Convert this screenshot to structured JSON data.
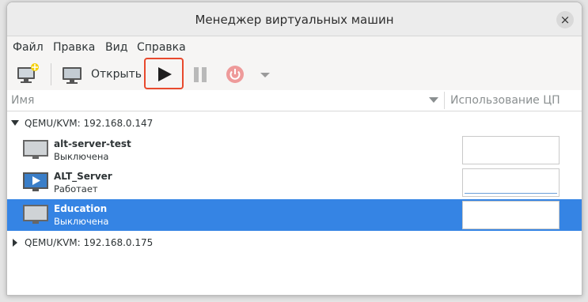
{
  "window": {
    "title": "Менеджер виртуальных машин",
    "close_glyph": "×"
  },
  "menu": [
    "Файл",
    "Правка",
    "Вид",
    "Справка"
  ],
  "toolbar": {
    "open_label": "Открыть",
    "icons": [
      "new-vm-icon",
      "monitor-icon",
      "play-icon",
      "pause-icon",
      "power-icon",
      "chevron-down-icon"
    ],
    "highlight_color": "#e8492d"
  },
  "columns": {
    "name": "Имя",
    "cpu": "Использование ЦП"
  },
  "connections": [
    {
      "label": "QEMU/KVM: 192.168.0.147",
      "expanded": true,
      "vms": [
        {
          "name": "alt-server-test",
          "state": "Выключена",
          "running": false,
          "selected": false
        },
        {
          "name": "ALT_Server",
          "state": "Работает",
          "running": true,
          "selected": false
        },
        {
          "name": "Education",
          "state": "Выключена",
          "running": false,
          "selected": true
        }
      ]
    },
    {
      "label": "QEMU/KVM: 192.168.0.175",
      "expanded": false,
      "vms": []
    }
  ],
  "colors": {
    "selection": "#3584e4",
    "accent": "#e8492d"
  }
}
